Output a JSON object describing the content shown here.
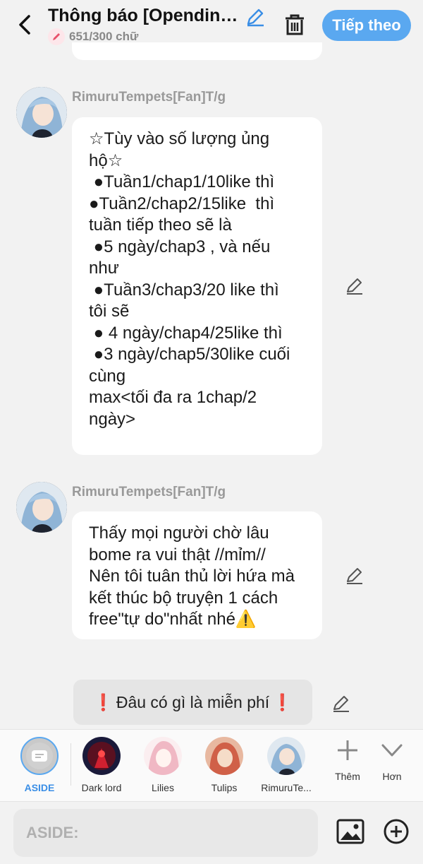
{
  "header": {
    "title": "Thông báo [Opending ...",
    "word_count": "651/300 chữ",
    "next_label": "Tiếp theo"
  },
  "messages": [
    {
      "sender": "RimuruTempets[Fan]T/g",
      "lines": [
        "☆Tùy vào số lượng ủng",
        "hộ☆",
        " ●Tuần1/chap1/10like thì",
        "●Tuần2/chap2/15like  thì",
        "tuần tiếp theo sẽ là",
        " ●5 ngày/chap3 , và nếu",
        "như",
        " ●Tuần3/chap3/20 like thì",
        "tôi sẽ",
        " ● 4 ngày/chap4/25like thì",
        " ●3 ngày/chap5/30like cuối",
        "cùng",
        "max<tối đa ra 1chap/2",
        "ngày>"
      ]
    },
    {
      "sender": "RimuruTempets[Fan]T/g",
      "lines": [
        "Thấy mọi người chờ lâu",
        "bome ra vui thật //mỉm//",
        "Nên tôi tuân thủ lời hứa mà",
        "kết thúc bộ truyện 1 cách",
        "free\"tự do\"nhất nhé⚠️"
      ]
    }
  ],
  "aside_message": {
    "text": "Đâu có gì là miễn phí",
    "mark": "❗"
  },
  "characters": [
    {
      "name": "ASIDE",
      "icon": "aside-icon"
    },
    {
      "name": "Dark lord",
      "icon": "dark-lord-avatar"
    },
    {
      "name": "Lilies",
      "icon": "lilies-avatar"
    },
    {
      "name": "Tulips",
      "icon": "tulips-avatar"
    },
    {
      "name": "RimuruTe...",
      "icon": "rimuru-avatar"
    }
  ],
  "tools": {
    "more_label": "Thêm",
    "less_label": "Hơn"
  },
  "input": {
    "placeholder": "ASIDE:"
  },
  "colors": {
    "accent": "#5aa8f0",
    "background": "#f2f2f2",
    "bubble": "#ffffff"
  }
}
